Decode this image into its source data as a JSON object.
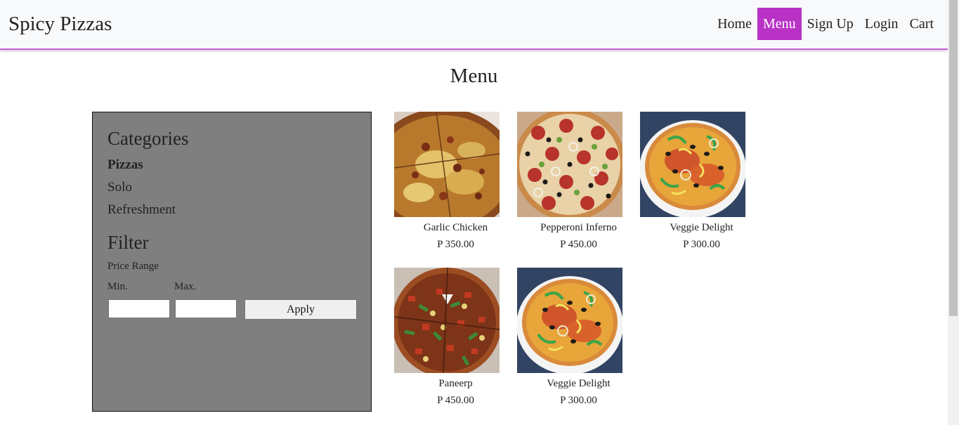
{
  "brand": "Spicy Pizzas",
  "nav": {
    "home": "Home",
    "menu": "Menu",
    "signup": "Sign Up",
    "login": "Login",
    "cart": "Cart"
  },
  "page_title": "Menu",
  "sidebar": {
    "categories_heading": "Categories",
    "categories": [
      "Pizzas",
      "Solo",
      "Refreshment"
    ],
    "filter_heading": "Filter",
    "price_range_label": "Price Range",
    "min_label": "Min.",
    "max_label": "Max.",
    "min_value": "",
    "max_value": "",
    "apply_label": "Apply"
  },
  "products": [
    {
      "name": "Garlic Chicken",
      "price": "P 350.00"
    },
    {
      "name": "Pepperoni Inferno",
      "price": "P 450.00"
    },
    {
      "name": "Veggie Delight",
      "price": "P 300.00"
    },
    {
      "name": "Paneerp",
      "price": "P 450.00"
    },
    {
      "name": "Veggie Delight",
      "price": "P 300.00"
    }
  ],
  "colors": {
    "accent": "#b932c6",
    "navbar_border": "#c95fd8",
    "sidebar_bg": "#7f7f7f"
  }
}
